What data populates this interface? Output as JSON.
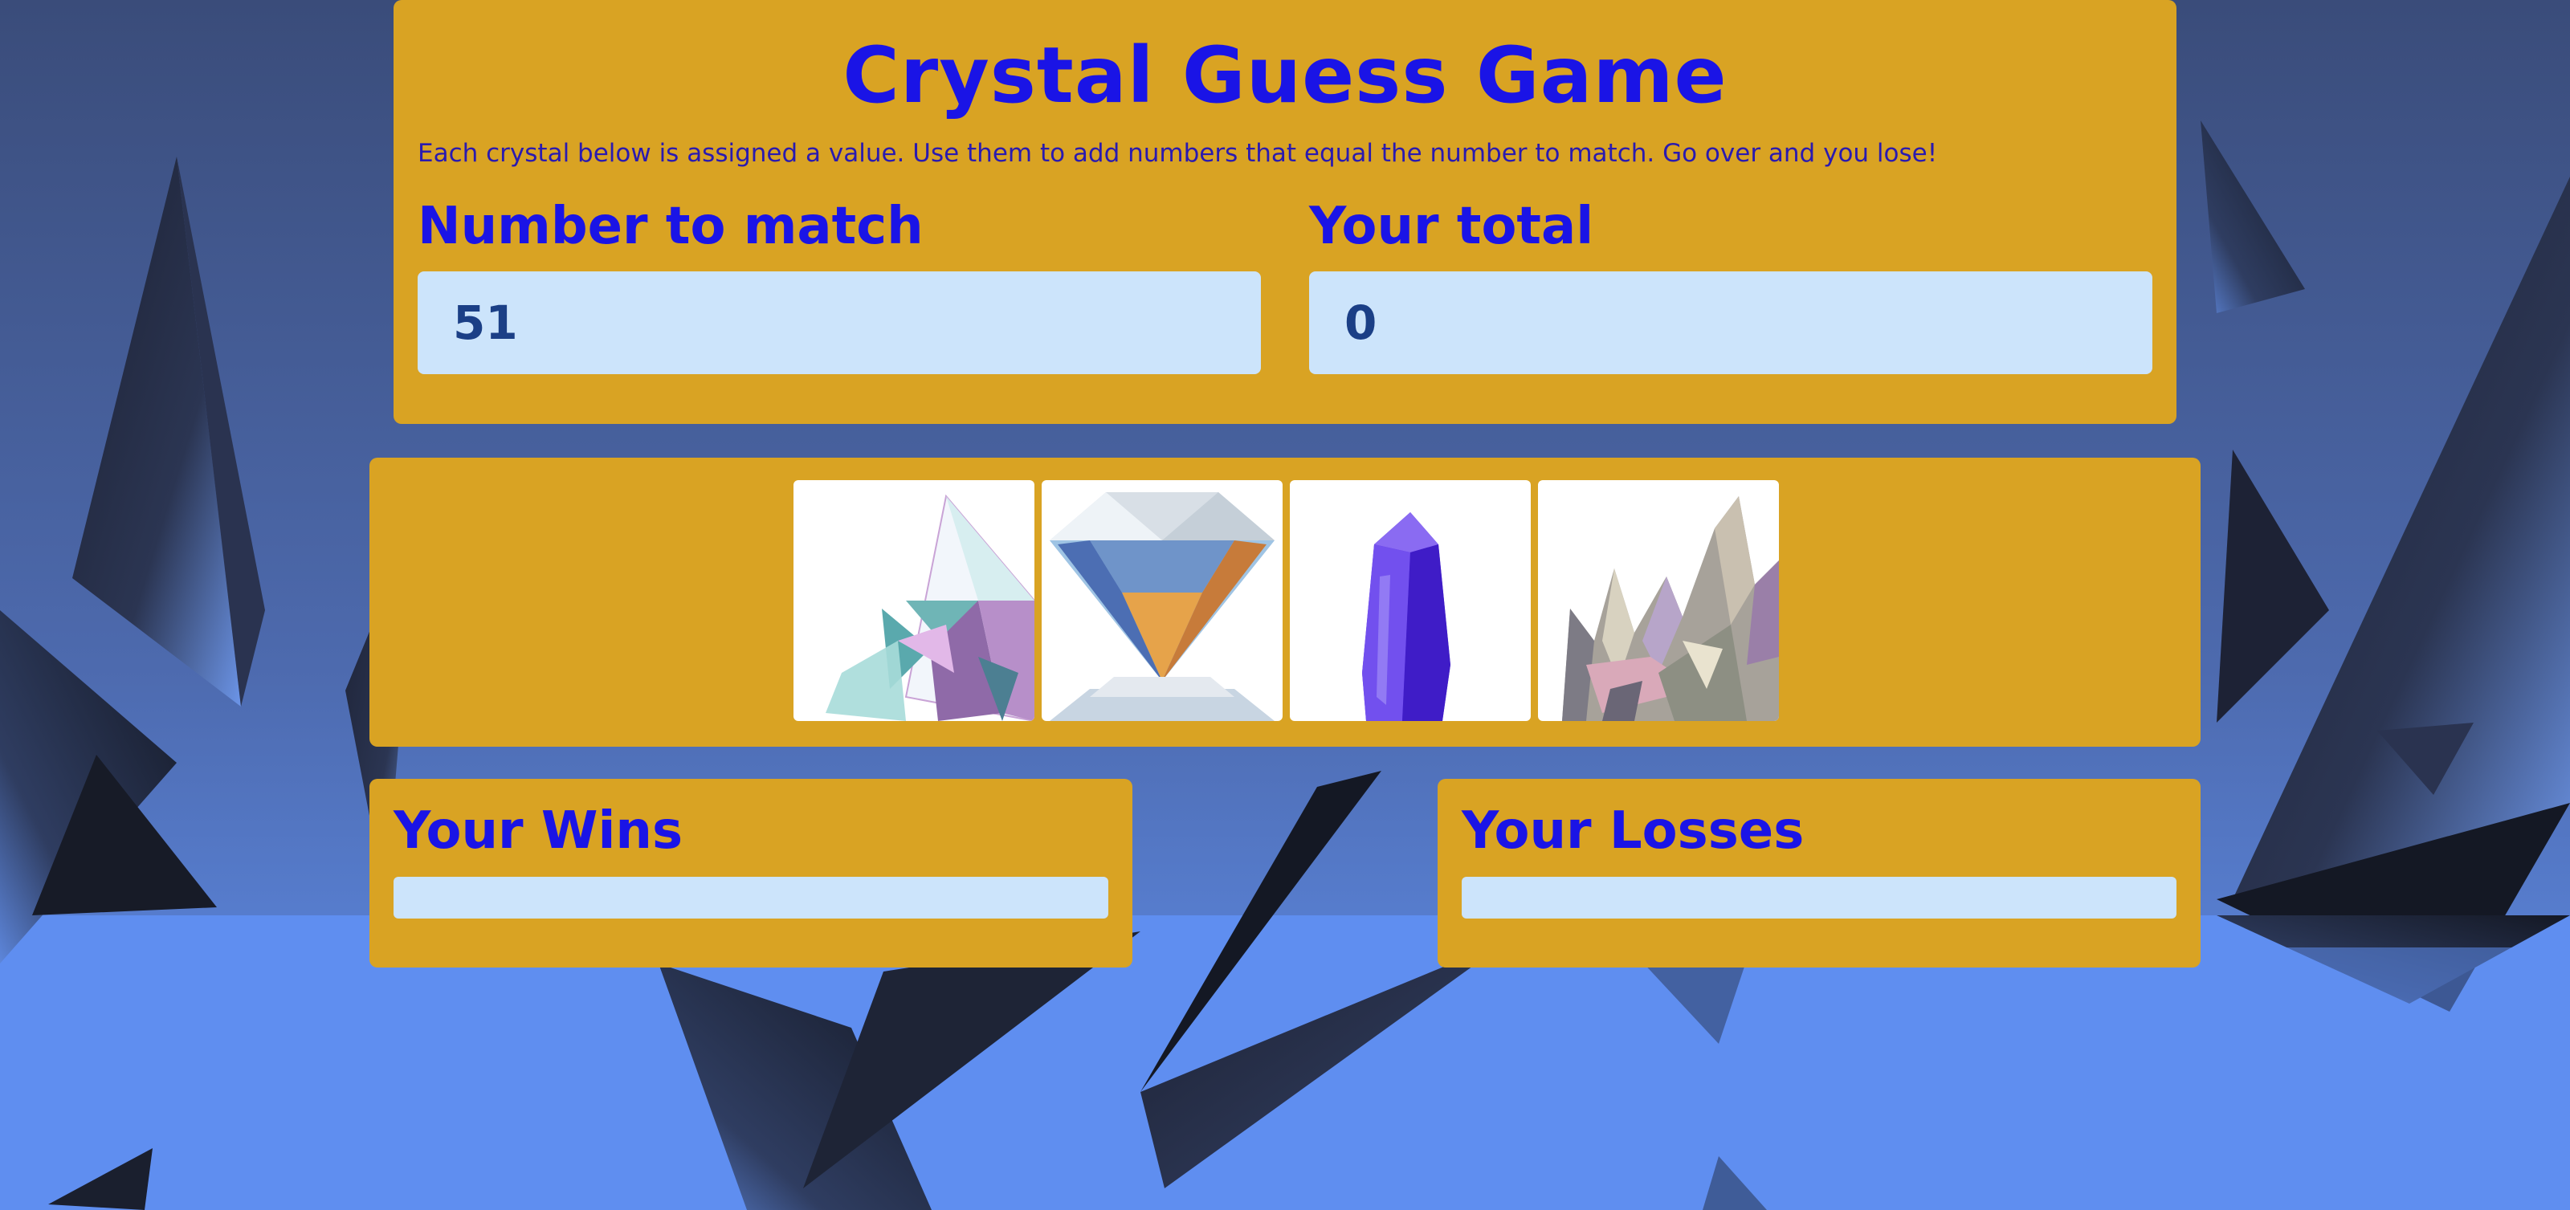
{
  "title": "Crystal Guess Game",
  "instructions": "Each crystal below is assigned a value. Use them to add numbers that equal the number to match. Go over and you lose!",
  "target": {
    "label": "Number to match",
    "value": "51"
  },
  "total": {
    "label": "Your total",
    "value": "0"
  },
  "crystals": [
    {
      "name": "crystal-cluster"
    },
    {
      "name": "diamond-gem"
    },
    {
      "name": "purple-crystal"
    },
    {
      "name": "iridescent-crystal"
    }
  ],
  "wins": {
    "label": "Your Wins",
    "value": ""
  },
  "losses": {
    "label": "Your Losses",
    "value": ""
  },
  "colors": {
    "panel": "#d9a323",
    "title": "#1a14e6",
    "value_box": "#cce4fb",
    "value_text": "#1b3f86"
  }
}
